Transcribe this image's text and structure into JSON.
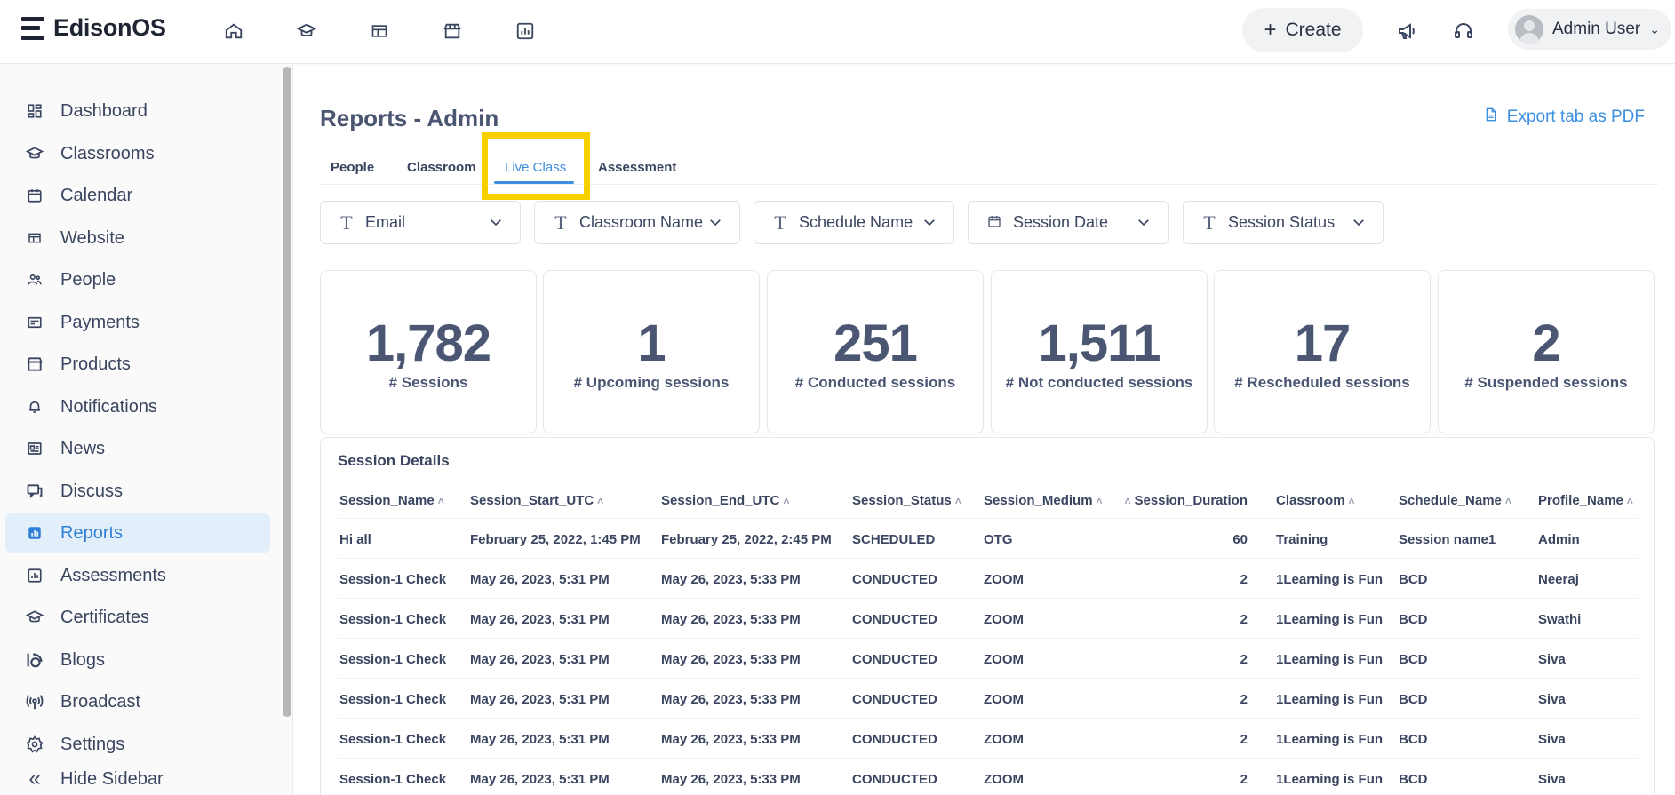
{
  "app": {
    "brand": "EdisonOS",
    "create_label": "Create",
    "user_name": "Admin User"
  },
  "top_nav": [
    {
      "icon": "home-icon"
    },
    {
      "icon": "graduation-cap-icon"
    },
    {
      "icon": "website-icon"
    },
    {
      "icon": "store-icon"
    },
    {
      "icon": "reports-chart-icon"
    }
  ],
  "sidebar": {
    "items": [
      {
        "label": "Dashboard",
        "icon": "dashboard-icon"
      },
      {
        "label": "Classrooms",
        "icon": "classroom-icon"
      },
      {
        "label": "Calendar",
        "icon": "calendar-icon"
      },
      {
        "label": "Website",
        "icon": "website-icon"
      },
      {
        "label": "People",
        "icon": "people-icon"
      },
      {
        "label": "Payments",
        "icon": "payments-icon"
      },
      {
        "label": "Products",
        "icon": "products-icon"
      },
      {
        "label": "Notifications",
        "icon": "bell-icon"
      },
      {
        "label": "News",
        "icon": "news-icon"
      },
      {
        "label": "Discuss",
        "icon": "discuss-icon"
      },
      {
        "label": "Reports",
        "icon": "reports-icon"
      },
      {
        "label": "Assessments",
        "icon": "assessments-icon"
      },
      {
        "label": "Certificates",
        "icon": "certificate-icon"
      },
      {
        "label": "Blogs",
        "icon": "blogs-icon"
      },
      {
        "label": "Broadcast",
        "icon": "broadcast-icon"
      },
      {
        "label": "Settings",
        "icon": "settings-icon"
      }
    ],
    "active_index": 10,
    "hide_label": "Hide Sidebar"
  },
  "main": {
    "title": "Reports - Admin",
    "export_label": "Export tab as PDF",
    "tabs": [
      "People",
      "Classroom",
      "Live Class",
      "Assessment"
    ],
    "active_tab": "Live Class",
    "filters": [
      {
        "label": "Email",
        "icon": "text-type-icon"
      },
      {
        "label": "Classroom Name",
        "icon": "text-type-icon"
      },
      {
        "label": "Schedule Name",
        "icon": "text-type-icon"
      },
      {
        "label": "Session Date",
        "icon": "calendar-icon"
      },
      {
        "label": "Session Status",
        "icon": "text-type-icon"
      }
    ],
    "stats": [
      {
        "value": "1,782",
        "label": "# Sessions"
      },
      {
        "value": "1",
        "label": "# Upcoming sessions"
      },
      {
        "value": "251",
        "label": "# Conducted sessions"
      },
      {
        "value": "1,511",
        "label": "# Not conducted sessions"
      },
      {
        "value": "17",
        "label": "# Rescheduled sessions"
      },
      {
        "value": "2",
        "label": "# Suspended sessions"
      }
    ],
    "table": {
      "title": "Session Details",
      "columns": [
        "Session_Name",
        "Session_Start_UTC",
        "Session_End_UTC",
        "Session_Status",
        "Session_Medium",
        "Session_Duration",
        "Classroom",
        "Schedule_Name",
        "Profile_Name"
      ],
      "rows": [
        [
          "Hi all",
          "February 25, 2022, 1:45 PM",
          "February 25, 2022, 2:45 PM",
          "SCHEDULED",
          "OTG",
          "60",
          "Training",
          "Session name1",
          "Admin"
        ],
        [
          "Session-1 Check",
          "May 26, 2023, 5:31 PM",
          "May 26, 2023, 5:33 PM",
          "CONDUCTED",
          "ZOOM",
          "2",
          "1Learning is Fun",
          "BCD",
          "Neeraj"
        ],
        [
          "Session-1 Check",
          "May 26, 2023, 5:31 PM",
          "May 26, 2023, 5:33 PM",
          "CONDUCTED",
          "ZOOM",
          "2",
          "1Learning is Fun",
          "BCD",
          "Swathi"
        ],
        [
          "Session-1 Check",
          "May 26, 2023, 5:31 PM",
          "May 26, 2023, 5:33 PM",
          "CONDUCTED",
          "ZOOM",
          "2",
          "1Learning is Fun",
          "BCD",
          "Siva"
        ],
        [
          "Session-1 Check",
          "May 26, 2023, 5:31 PM",
          "May 26, 2023, 5:33 PM",
          "CONDUCTED",
          "ZOOM",
          "2",
          "1Learning is Fun",
          "BCD",
          "Siva"
        ],
        [
          "Session-1 Check",
          "May 26, 2023, 5:31 PM",
          "May 26, 2023, 5:33 PM",
          "CONDUCTED",
          "ZOOM",
          "2",
          "1Learning is Fun",
          "BCD",
          "Siva"
        ],
        [
          "Session-1 Check",
          "May 26, 2023, 5:31 PM",
          "May 26, 2023, 5:33 PM",
          "CONDUCTED",
          "ZOOM",
          "2",
          "1Learning is Fun",
          "BCD",
          "Siva"
        ]
      ]
    }
  },
  "colors": {
    "accent": "#3d8fe0",
    "active_bg": "#e3eefb",
    "highlight": "#f7ce00",
    "text": "#3a4560"
  }
}
